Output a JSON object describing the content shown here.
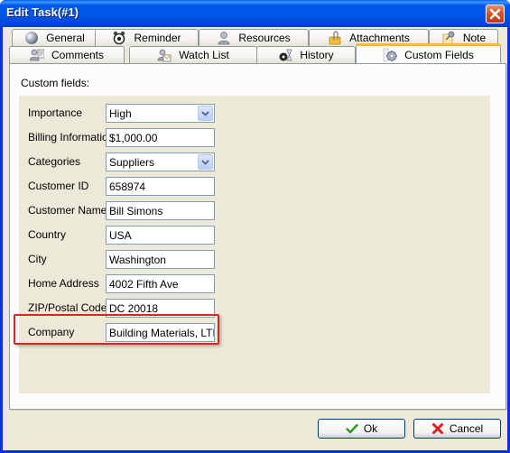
{
  "window": {
    "title": "Edit Task(#1)"
  },
  "tabs_row1": [
    {
      "label": "General",
      "icon": "sphere-icon"
    },
    {
      "label": "Reminder",
      "icon": "alarm-clock-icon"
    },
    {
      "label": "Resources",
      "icon": "person-icon"
    },
    {
      "label": "Attachments",
      "icon": "paperclip-folder-icon"
    },
    {
      "label": "Note",
      "icon": "pushpin-note-icon"
    }
  ],
  "tabs_row2": [
    {
      "label": "Comments",
      "icon": "comments-icon"
    },
    {
      "label": "Watch List",
      "icon": "watch-list-icon"
    },
    {
      "label": "History",
      "icon": "history-icon"
    },
    {
      "label": "Custom Fields",
      "icon": "gear-icon",
      "active": true
    }
  ],
  "custom_fields": {
    "section_label": "Custom fields:",
    "fields": [
      {
        "label": "Importance",
        "value": "High",
        "type": "dropdown"
      },
      {
        "label": "Billing Information",
        "value": "$1,000.00",
        "type": "text"
      },
      {
        "label": "Categories",
        "value": "Suppliers",
        "type": "dropdown"
      },
      {
        "label": "Customer ID",
        "value": "658974",
        "type": "text"
      },
      {
        "label": "Customer Name",
        "value": "Bill Simons",
        "type": "text"
      },
      {
        "label": "Country",
        "value": "USA",
        "type": "text"
      },
      {
        "label": "City",
        "value": "Washington",
        "type": "text"
      },
      {
        "label": "Home Address",
        "value": "4002 Fifth Ave",
        "type": "text"
      },
      {
        "label": "ZIP/Postal Code",
        "value": "DC 20018",
        "type": "text"
      },
      {
        "label": "Company",
        "value": "Building Materials, LTD",
        "type": "text",
        "highlighted": true
      }
    ]
  },
  "buttons": {
    "ok_label": "Ok",
    "cancel_label": "Cancel"
  },
  "colors": {
    "titlebar": "#0055e5",
    "active_tab_accent": "#f6b73c",
    "highlight": "#e22222",
    "panel_bg": "#ece9d8"
  }
}
